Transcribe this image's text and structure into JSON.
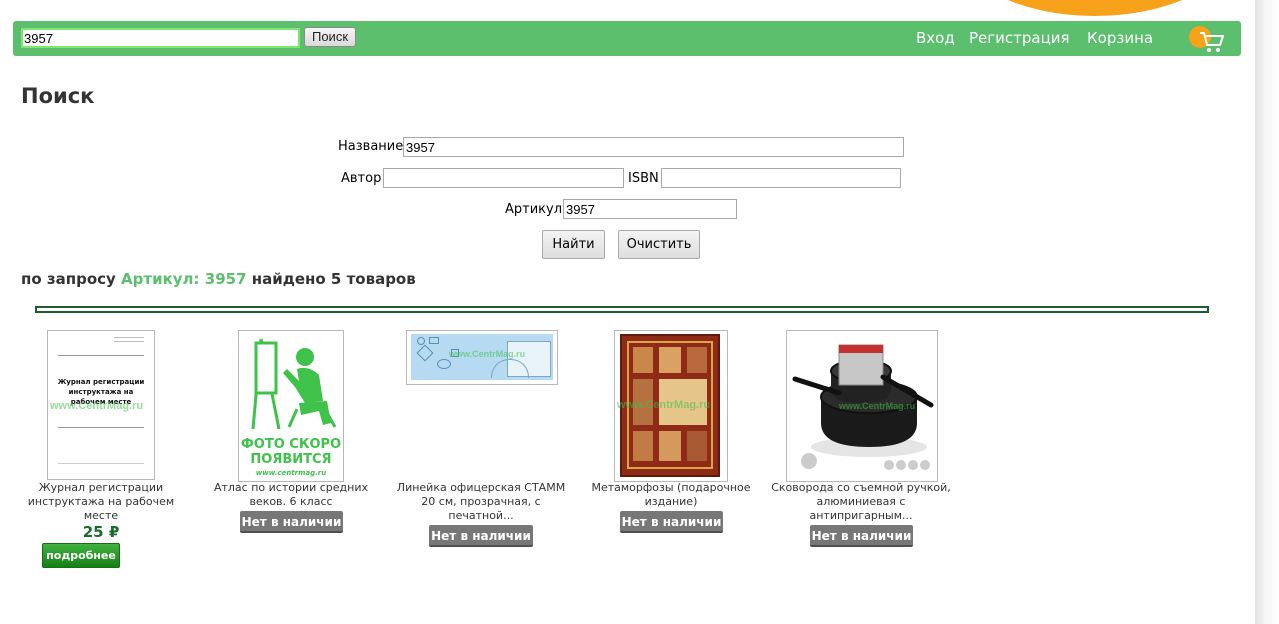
{
  "header": {
    "search_value": "3957",
    "search_button": "Поиск",
    "nav": {
      "login": "Вход",
      "register": "Регистрация",
      "cart": "Корзина"
    },
    "accent_color": "#5bbf6e",
    "cart_badge_color": "#f7a21a"
  },
  "page": {
    "title": "Поиск"
  },
  "form": {
    "name_label": "Название",
    "name_value": "3957",
    "author_label": "Автор",
    "author_value": "",
    "isbn_label": "ISBN",
    "isbn_value": "",
    "article_label": "Артикул",
    "article_value": "3957",
    "find_button": "Найти",
    "clear_button": "Очистить"
  },
  "results": {
    "prefix": "по запросу",
    "query": "Артикул: 3957",
    "suffix": "найдено 5 товаров"
  },
  "products": [
    {
      "name": "Журнал регистрации инструктажа на рабочем месте",
      "cover_text": "Журнал регистрации инструктажа на рабочем месте",
      "watermark": "www.CentrMag.ru",
      "price": "25 ₽",
      "more_button": "подробнее",
      "icon": "document-cover-image"
    },
    {
      "name": "Атлас по истории средних веков. 6 класс",
      "placeholder_text": "ФОТО СКОРО ПОЯВИТСЯ",
      "placeholder_site": "www.centrmag.ru",
      "status": "Нет в наличии",
      "icon": "painter-placeholder-image"
    },
    {
      "name": "Линейка офицерская СТАММ 20 см, прозрачная, с печатной...",
      "watermark": "www.CentrMag.ru",
      "status": "Нет в наличии",
      "icon": "ruler-image"
    },
    {
      "name": "Метаморфозы (подарочное издание)",
      "watermark": "www.CentrMag.ru",
      "status": "Нет в наличии",
      "icon": "book-cover-image"
    },
    {
      "name": "Сковорода со съемной ручкой, алюминиевая с антипригарным...",
      "watermark": "www.CentrMag.ru",
      "status": "Нет в наличии",
      "icon": "frying-pan-image"
    }
  ]
}
